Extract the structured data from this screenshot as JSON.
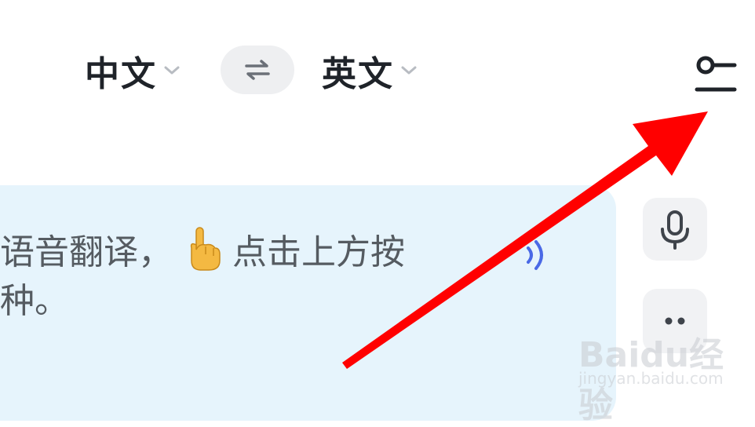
{
  "header": {
    "source_language": "中文",
    "target_language": "英文"
  },
  "prompt": {
    "line1_start": "语音翻译，",
    "line1_end": "点击上方按",
    "line2": "种。"
  },
  "watermark": {
    "brand": "Baidu经验",
    "url": "jingyan.baidu.com"
  },
  "colors": {
    "accent": "#4a69e6",
    "panel": "#e6f4fc",
    "arrow": "#ff0000"
  },
  "icons": {
    "swap": "swap-arrows-icon",
    "settings": "settings-slider-icon",
    "mic": "microphone-icon",
    "more": "more-dots-icon",
    "sound": "sound-waves-icon",
    "hand": "pointing-hand-icon"
  }
}
